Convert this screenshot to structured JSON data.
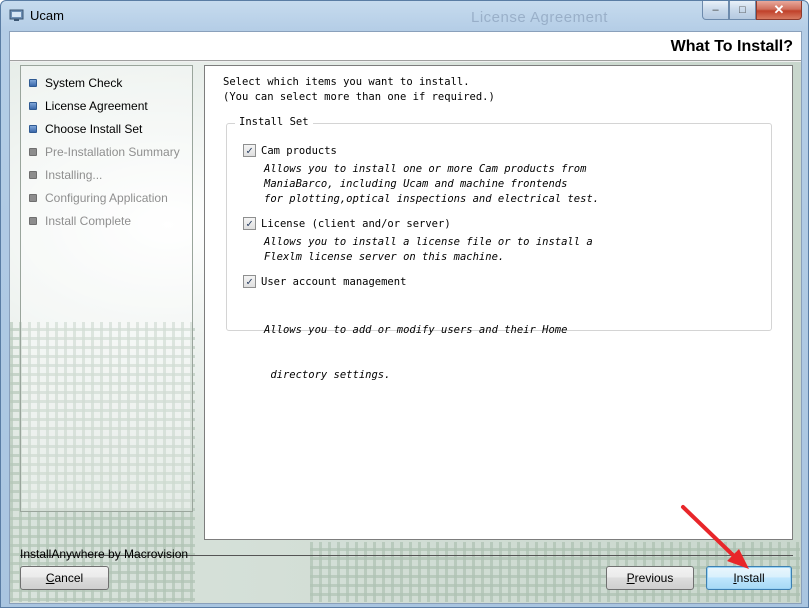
{
  "window": {
    "title": "Ucam",
    "ghost_title": "License Agreement",
    "controls": {
      "minimize": "–",
      "maximize": "□",
      "close": "✕"
    }
  },
  "header": {
    "title": "What To Install?"
  },
  "steps": [
    {
      "label": "System Check",
      "state": "done"
    },
    {
      "label": "License Agreement",
      "state": "done"
    },
    {
      "label": "Choose Install Set",
      "state": "done"
    },
    {
      "label": "Pre-Installation Summary",
      "state": "todo"
    },
    {
      "label": "Installing...",
      "state": "todo"
    },
    {
      "label": "Configuring Application",
      "state": "todo"
    },
    {
      "label": "Install Complete",
      "state": "todo"
    }
  ],
  "content": {
    "intro_line1": "Select which items you want to install.",
    "intro_line2": "(You can select more than one if required.)",
    "group_title": "Install Set",
    "items": [
      {
        "label": "Cam products",
        "checked": true,
        "desc": [
          "Allows you to install one or more Cam products from",
          "ManiaBarco, including Ucam and machine frontends",
          "for plotting,optical inspections and electrical test."
        ]
      },
      {
        "label": "License (client and/or server)",
        "checked": true,
        "desc": [
          "Allows you to install a license file or to install a",
          "Flexlm license server on this machine."
        ]
      },
      {
        "label": "User account management",
        "checked": true,
        "desc": [
          "Allows you to add or modify users and their Home",
          " directory settings."
        ]
      }
    ]
  },
  "footer": {
    "brand": "InstallAnywhere by Macrovision",
    "cancel_mnemonic": "C",
    "cancel_rest": "ancel",
    "previous_mnemonic": "P",
    "previous_rest": "revious",
    "install_mnemonic": "I",
    "install_rest": "nstall"
  },
  "colors": {
    "annotation_arrow": "#e8262a",
    "step_done": "#3a68aa",
    "step_todo": "#8d8d8d"
  },
  "icons": {
    "checkbox_checked": "✓"
  }
}
